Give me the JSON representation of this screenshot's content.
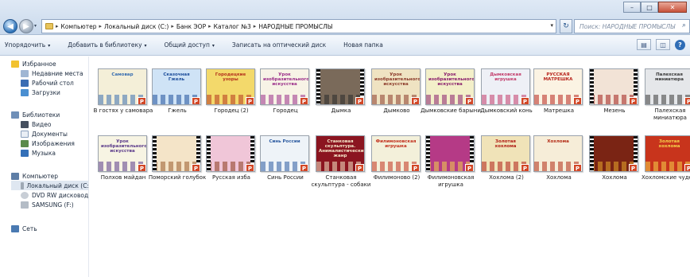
{
  "window": {
    "minimize": "–",
    "maximize": "□",
    "close": "✕"
  },
  "nav": {
    "back": "◀",
    "forward": "▶",
    "dropdown": "▾"
  },
  "breadcrumb": [
    "Компьютер",
    "Локальный диск (C:)",
    "Банк ЭОР",
    "Каталог №3",
    "НАРОДНЫЕ ПРОМЫСЛЫ"
  ],
  "breadcrumb_separator": "▸",
  "address_dropdown": "▾",
  "refresh_glyph": "↻",
  "search": {
    "placeholder": "Поиск: НАРОДНЫЕ ПРОМЫСЛЫ",
    "icon": "search-icon",
    "glyph": "⌕"
  },
  "toolbar": {
    "organize": "Упорядочить",
    "add_to_library": "Добавить в библиотеку",
    "share": "Общий доступ",
    "burn": "Записать на оптический диск",
    "new_folder": "Новая папка",
    "arrow": "▾",
    "view_icon": "▤",
    "pane_icon": "◫",
    "help_glyph": "?"
  },
  "sidebar": {
    "favorites": "Избранное",
    "recent": "Недавние места",
    "desktop": "Рабочий стол",
    "downloads": "Загрузки",
    "libraries": "Библиотеки",
    "video": "Видео",
    "documents": "Документы",
    "images": "Изображения",
    "music": "Музыка",
    "computer": "Компьютер",
    "local_disk": "Локальный диск (С:",
    "dvd": "DVD RW дисковод (E",
    "samsung": "SAMSUNG (F:)",
    "network": "Сеть"
  },
  "file_badge": "P",
  "files": [
    {
      "name": "В гостях у самовара",
      "thumb_text": "Самовар",
      "bg": "#f4efd8",
      "accent": "#3a6fb0"
    },
    {
      "name": "Гжель",
      "thumb_text": "Сказочная Гжель",
      "bg": "#cfe3f6",
      "accent": "#1f4f9c"
    },
    {
      "name": "Городец (2)",
      "thumb_text": "Городецкие узоры",
      "bg": "#f3d96b",
      "accent": "#b5351e"
    },
    {
      "name": "Городец",
      "thumb_text": "Урок изобразительного искусства",
      "bg": "#f7f3e6",
      "accent": "#9b2f8a"
    },
    {
      "name": "Дымка",
      "thumb_text": "",
      "bg": "#7a6a5a",
      "accent": "#2b2b2b"
    },
    {
      "name": "Дымково",
      "thumb_text": "Урок изобразительного искусства",
      "bg": "#efe3c2",
      "accent": "#8c3b2b"
    },
    {
      "name": "Дымковские барыни",
      "thumb_text": "Урок изобразительного искусства",
      "bg": "#f3efc9",
      "accent": "#8a1f6c"
    },
    {
      "name": "Дымковский конь",
      "thumb_text": "Дымковская игрушка",
      "bg": "#eef0f6",
      "accent": "#c23b6a"
    },
    {
      "name": "Матрешка",
      "thumb_text": "РУССКАЯ МАТРЕШКА",
      "bg": "#fbf3e3",
      "accent": "#b8261e"
    },
    {
      "name": "Мезень",
      "thumb_text": "",
      "bg": "#f2e3d6",
      "accent": "#a11f1a"
    },
    {
      "name": "Палехская миниатюра",
      "thumb_text": "Палехская миниатюра",
      "bg": "#e5e7ea",
      "accent": "#3a3a3a"
    },
    {
      "name": "Полхов майдан",
      "thumb_text": "Урок изобразительного искусства",
      "bg": "#f7f4e3",
      "accent": "#5a3a8a"
    },
    {
      "name": "Поморский голубок",
      "thumb_text": "",
      "bg": "#f4e4c8",
      "accent": "#9a5a2a"
    },
    {
      "name": "Русская изба",
      "thumb_text": "",
      "bg": "#f0c6d8",
      "accent": "#8a3a1a"
    },
    {
      "name": "Синь России",
      "thumb_text": "Синь России",
      "bg": "#eef3f8",
      "accent": "#2b5aa0"
    },
    {
      "name": "Станковая скульптура - собаки",
      "thumb_text": "Станковая скульптура. Анималистический жанр",
      "bg": "#8b1520",
      "accent": "#f5e6c8"
    },
    {
      "name": "Филимоново (2)",
      "thumb_text": "Филимоновская игрушка",
      "bg": "#f3f0da",
      "accent": "#c2311e"
    },
    {
      "name": "Филимоновская игрушка",
      "thumb_text": "",
      "bg": "#b53a86",
      "accent": "#f2d34a"
    },
    {
      "name": "Хохлома (2)",
      "thumb_text": "Золотая хохлома",
      "bg": "#f0e3b8",
      "accent": "#b01c14"
    },
    {
      "name": "Хохлома",
      "thumb_text": "Хохлома",
      "bg": "#f6edd8",
      "accent": "#b22a14"
    },
    {
      "name": "Хохлома",
      "thumb_text": "",
      "bg": "#7a2414",
      "accent": "#e8a82a"
    },
    {
      "name": "Хохломские чудеса",
      "thumb_text": "Золотая хохлома",
      "bg": "#c8341c",
      "accent": "#f6d24a"
    }
  ]
}
